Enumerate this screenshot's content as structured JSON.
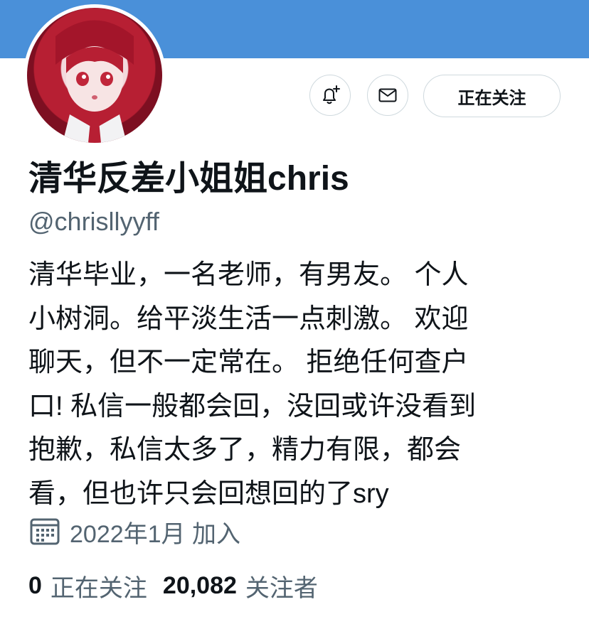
{
  "colors": {
    "banner": "#4a90d9",
    "text_primary": "#0f1419",
    "text_secondary": "#536471",
    "button_border": "#cfd9de"
  },
  "header": {
    "avatar_icon": "avatar-image",
    "notify_icon": "bell-plus-icon",
    "message_icon": "envelope-icon",
    "follow_button_label": "正在关注"
  },
  "profile": {
    "display_name": "清华反差小姐姐chris",
    "handle": "@chrisllyyff",
    "bio_lines": [
      "清华毕业，一名老师，有男友。 个人",
      "小树洞。给平淡生活一点刺激。 欢迎",
      "聊天，但不一定常在。 拒绝任何查户",
      "口! 私信一般都会回，没回或许没看到",
      "抱歉，私信太多了，精力有限，都会",
      "看，但也许只会回想回的了sry"
    ],
    "joined_icon": "calendar-icon",
    "joined": "2022年1月 加入"
  },
  "stats": {
    "following_count": "0",
    "following_label": "正在关注",
    "followers_count": "20,082",
    "followers_label": "关注者"
  }
}
